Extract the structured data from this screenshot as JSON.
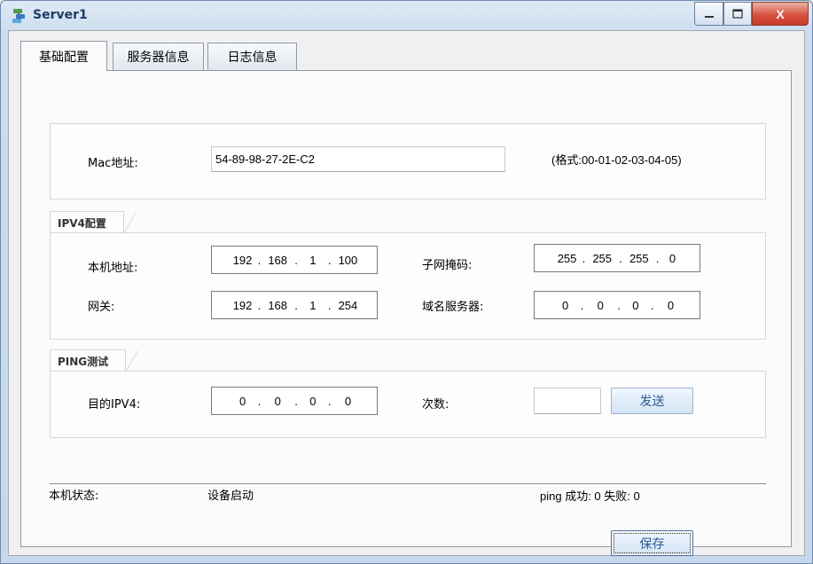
{
  "window": {
    "title": "Server1",
    "close_label": "X"
  },
  "tabs": [
    {
      "label": "基础配置",
      "active": true
    },
    {
      "label": "服务器信息",
      "active": false
    },
    {
      "label": "日志信息",
      "active": false
    }
  ],
  "mac": {
    "label": "Mac地址:",
    "value": "54-89-98-27-2E-C2",
    "format_hint": "(格式:00-01-02-03-04-05)"
  },
  "ipv4": {
    "legend": "IPV4配置",
    "local_label": "本机地址:",
    "local_ip": [
      "192",
      "168",
      "1",
      "100"
    ],
    "mask_label": "子网掩码:",
    "mask": [
      "255",
      "255",
      "255",
      "0"
    ],
    "gateway_label": "网关:",
    "gateway": [
      "192",
      "168",
      "1",
      "254"
    ],
    "dns_label": "域名服务器:",
    "dns": [
      "0",
      "0",
      "0",
      "0"
    ]
  },
  "ping": {
    "legend": "PING测试",
    "dest_label": "目的IPV4:",
    "dest": [
      "0",
      "0",
      "0",
      "0"
    ],
    "count_label": "次数:",
    "count_value": "",
    "send_label": "发送"
  },
  "status": {
    "label": "本机状态:",
    "value": "设备启动",
    "ping_result": "ping 成功: 0 失败: 0"
  },
  "save_label": "保存",
  "colors": {
    "title_text": "#1c3c66",
    "button_text": "#2c5a96",
    "close_button": "#d7523f"
  }
}
